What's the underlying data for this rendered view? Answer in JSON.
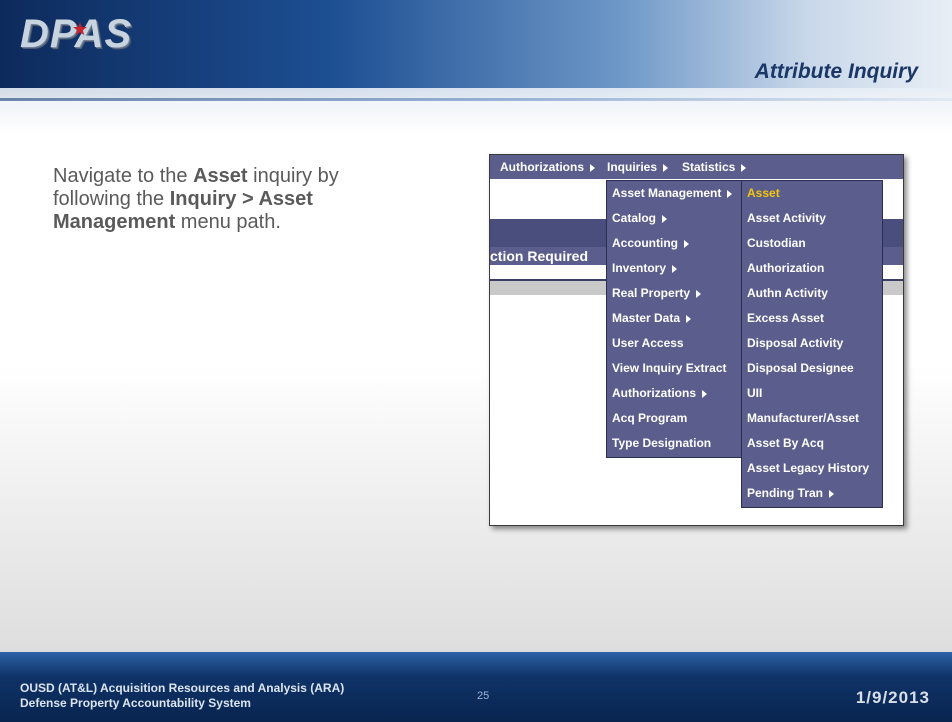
{
  "header": {
    "logo_text": "DPAS",
    "slide_title": "Attribute Inquiry"
  },
  "instructions": {
    "p1": "Navigate to the ",
    "b1": "Asset",
    "p2": " inquiry by following the ",
    "b2": "Inquiry > Asset Management",
    "p3": " menu path."
  },
  "screenshot": {
    "menubar": [
      "Authorizations",
      "Inquiries",
      "Statistics"
    ],
    "action_label": "ction Required",
    "inquiries_menu": [
      "Asset Management",
      "Catalog",
      "Accounting",
      "Inventory",
      "Real Property",
      "Master Data",
      "User Access",
      "View Inquiry Extract",
      "Authorizations",
      "Acq Program",
      "Type Designation"
    ],
    "asset_management_menu": [
      "Asset",
      "Asset Activity",
      "Custodian",
      "Authorization",
      "Authn Activity",
      "Excess Asset",
      "Disposal Activity",
      "Disposal Designee",
      "UII",
      "Manufacturer/Asset",
      "Asset By Acq",
      "Asset Legacy History",
      "Pending Tran"
    ],
    "selected_item": "Asset"
  },
  "footer": {
    "line1": "OUSD (AT&L) Acquisition Resources and Analysis (ARA)",
    "line2": "Defense Property Accountability System",
    "page_number": "25",
    "date": "1/9/2013"
  },
  "colors": {
    "menu_bg": "#5b5e8c",
    "selected_text": "#f4c30a",
    "title_blue": "#1a3766"
  }
}
